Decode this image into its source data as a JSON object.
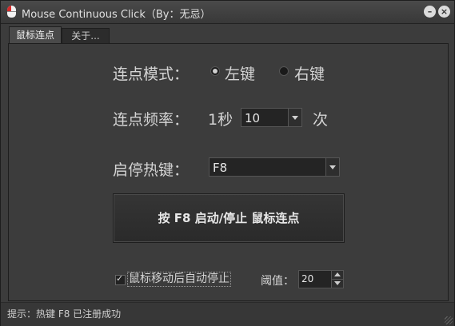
{
  "window": {
    "title": "Mouse Continuous Click（By：无忌）"
  },
  "controls": {
    "minimize": "–",
    "close": "×"
  },
  "tabs": [
    {
      "label": "鼠标连点"
    },
    {
      "label": "关于..."
    }
  ],
  "mode": {
    "label": "连点模式：",
    "options": [
      {
        "label": "左键",
        "selected": true
      },
      {
        "label": "右键",
        "selected": false
      }
    ]
  },
  "frequency": {
    "label": "连点频率：",
    "unit_prefix": "1秒",
    "value": "10",
    "unit_suffix": "次"
  },
  "hotkey": {
    "label": "启停热键：",
    "value": "F8"
  },
  "main_button": {
    "label": "按 F8 启动/停止 鼠标连点"
  },
  "auto_stop": {
    "checked": true,
    "label": "鼠标移动后自动停止",
    "threshold_label": "阈值：",
    "threshold_value": "20"
  },
  "status": {
    "text": "提示：热键 F8 已注册成功"
  },
  "colors": {
    "background": "#3c3c3c",
    "titlebar": "#404040",
    "text": "#d4d4d4"
  }
}
